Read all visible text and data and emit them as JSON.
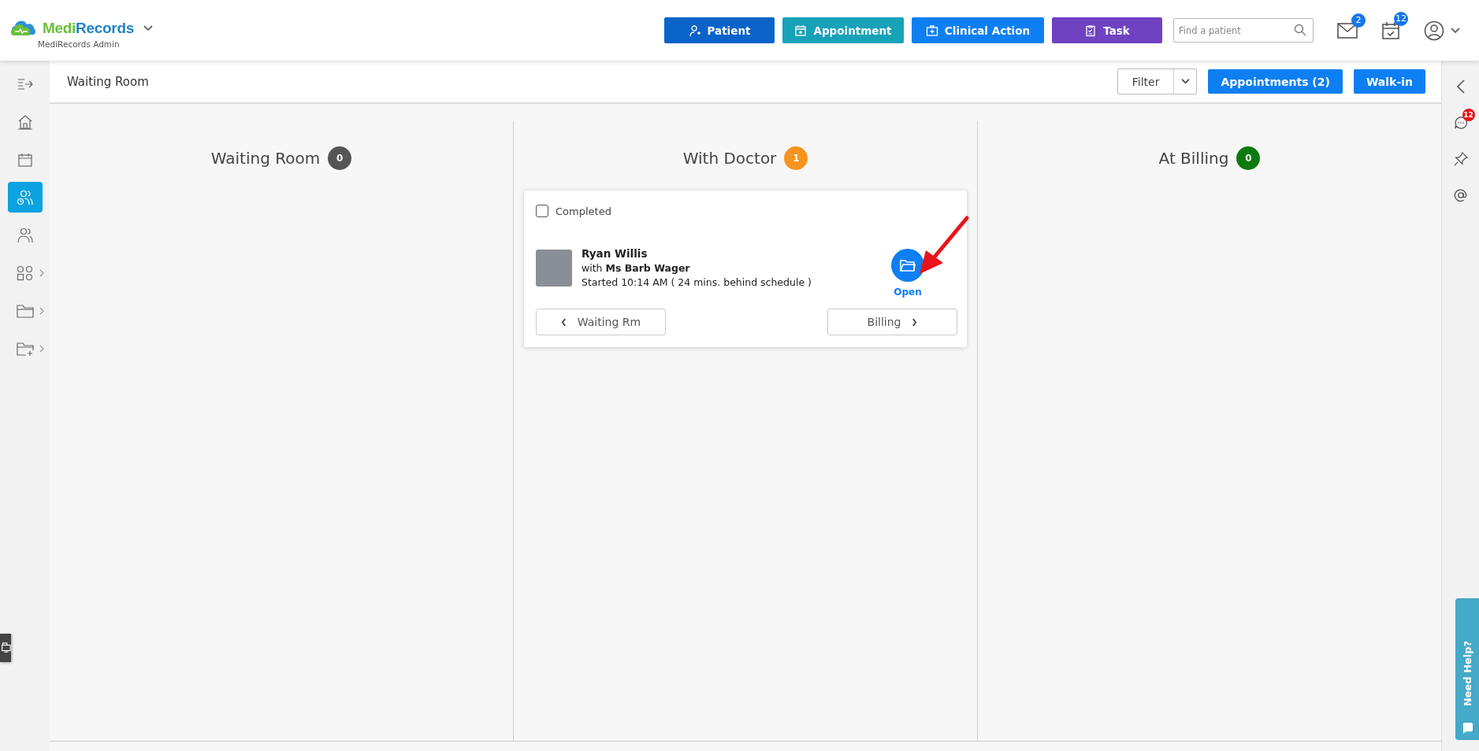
{
  "header": {
    "brand_parts": [
      "Medi",
      "Records"
    ],
    "org": "MediRecords Admin",
    "actions": [
      {
        "label": "Patient",
        "color": "#0a63c9"
      },
      {
        "label": "Appointment",
        "color": "#17a2b8"
      },
      {
        "label": "Clinical Action",
        "color": "#0d7ff2"
      },
      {
        "label": "Task",
        "color": "#6f42c1"
      }
    ],
    "search": {
      "placeholder": "Find a patient"
    },
    "mail_badge": "2",
    "calendar_badge": "12"
  },
  "sidebar": {
    "items": [
      {
        "selected": false,
        "submenu": false
      },
      {
        "selected": false,
        "submenu": false
      },
      {
        "selected": false,
        "submenu": false
      },
      {
        "selected": true,
        "submenu": false
      },
      {
        "selected": false,
        "submenu": false
      },
      {
        "selected": false,
        "submenu": true
      },
      {
        "selected": false,
        "submenu": true
      },
      {
        "selected": false,
        "submenu": true
      }
    ]
  },
  "toolbar": {
    "title": "Waiting Room",
    "filter": "Filter",
    "appointments": "Appointments (2)",
    "walk_in": "Walk-in"
  },
  "columns": [
    {
      "title": "Waiting Room",
      "count": "0",
      "color": "#555555"
    },
    {
      "title": "With Doctor",
      "count": "1",
      "color": "#f7941d",
      "cards": [
        {
          "completed": false,
          "completed_label": "Completed",
          "patient": "Ryan Willis",
          "with_prefix": "with",
          "doctor": "Ms Barb Wager",
          "started": "Started 10:14 AM ( 24 mins. behind schedule )",
          "open": "Open",
          "back": "Waiting Rm",
          "forward": "Billing"
        }
      ]
    },
    {
      "title": "At Billing",
      "count": "0",
      "color": "#0f7a0f"
    }
  ],
  "right_rail": {
    "chat_badge": "12",
    "help": "Need Help?"
  }
}
